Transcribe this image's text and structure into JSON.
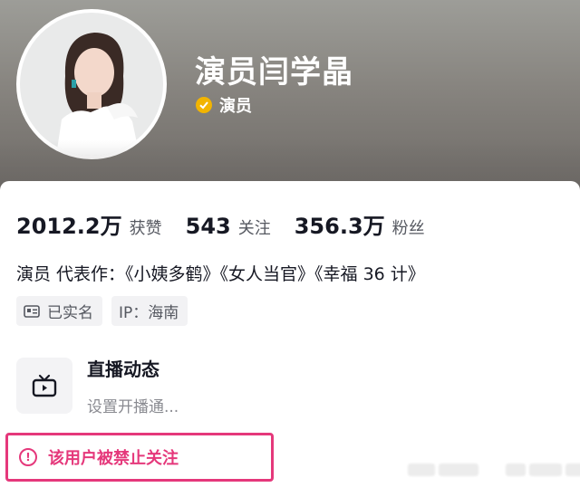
{
  "profile": {
    "nickname": "演员闫学晶",
    "verify_label": "演员",
    "verify_color": "#f2b400"
  },
  "stats": [
    {
      "value": "2012.2万",
      "label": "获赞"
    },
    {
      "value": "543",
      "label": "关注"
    },
    {
      "value": "356.3万",
      "label": "粉丝"
    }
  ],
  "bio": "演员 代表作：《小姨多鹤》《女人当官》《幸福 36 计》",
  "tags": [
    {
      "icon": "id-card-icon",
      "label": "已实名"
    },
    {
      "label": "IP：海南"
    }
  ],
  "live": {
    "icon": "tv-icon",
    "title": "直播动态",
    "subtitle": "设置开播通..."
  },
  "ban_notice": {
    "icon": "exclamation-circle-icon",
    "text": "该用户被禁止关注",
    "color": "#e5387b"
  }
}
